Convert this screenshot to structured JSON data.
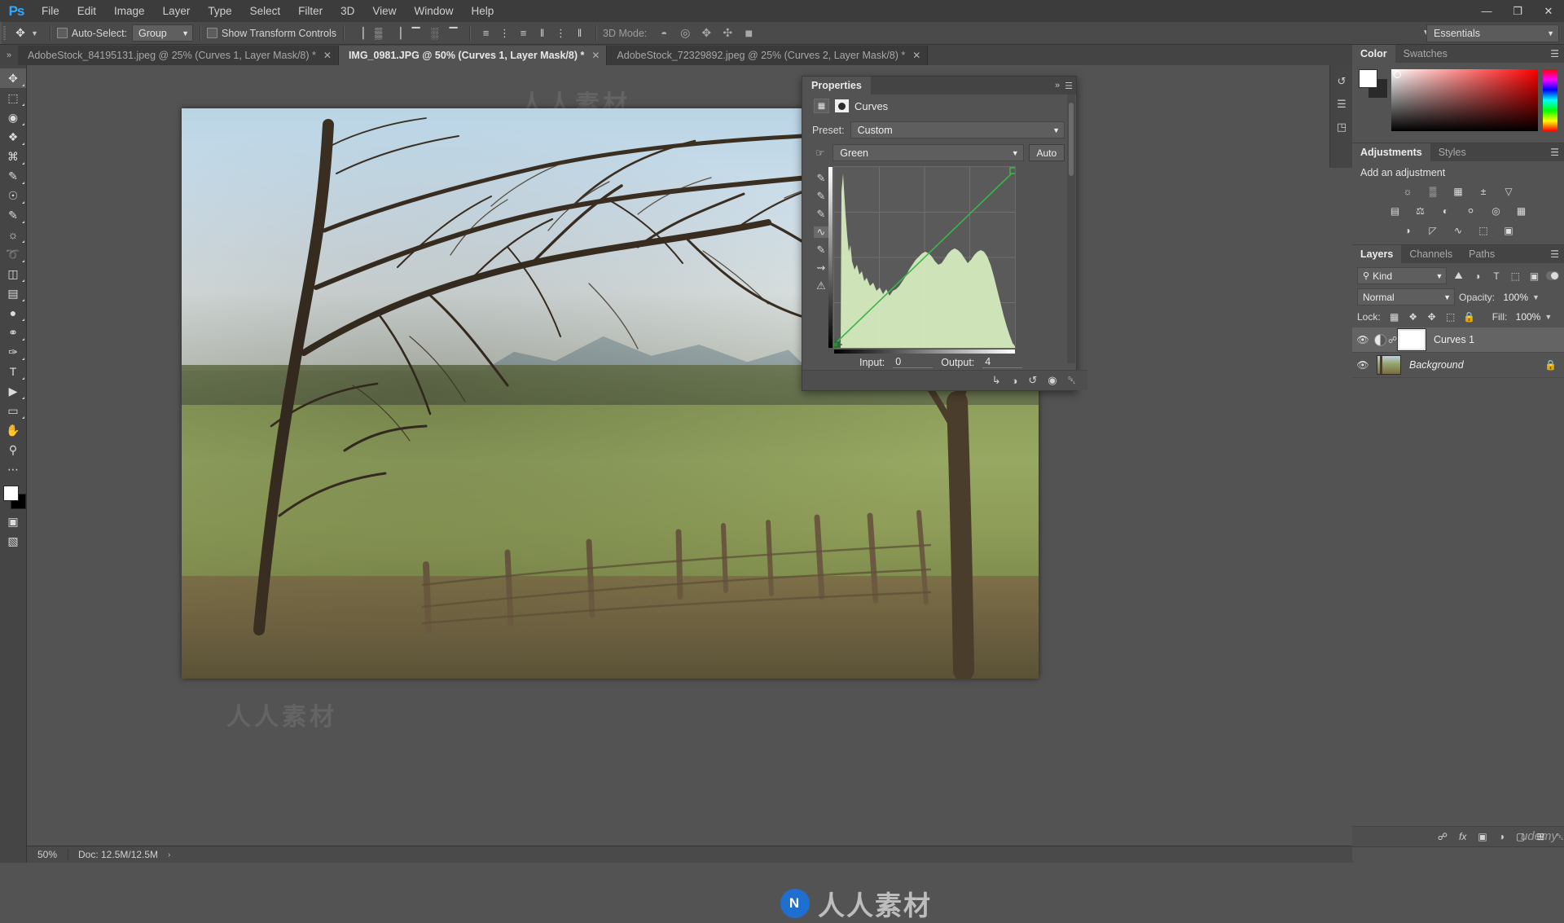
{
  "app": {
    "name": "Ps",
    "logo_icon": "photoshop-logo-icon",
    "workspace": "Essentials"
  },
  "menubar": {
    "items": [
      "File",
      "Edit",
      "Image",
      "Layer",
      "Type",
      "Select",
      "Filter",
      "3D",
      "View",
      "Window",
      "Help"
    ],
    "window_controls": {
      "minimize": "—",
      "maximize": "❐",
      "close": "✕"
    }
  },
  "options_bar": {
    "tool_icon": "move-tool-icon",
    "auto_select_label": "Auto-Select:",
    "auto_select_value": "Group",
    "show_transform_label": "Show Transform Controls",
    "three_d_mode_label": "3D Mode:",
    "align_icons": [
      "align-left-edges-icon",
      "align-horizontal-centers-icon",
      "align-right-edges-icon",
      "align-top-edges-icon",
      "align-vertical-centers-icon",
      "align-bottom-edges-icon"
    ],
    "distribute_icons": [
      "distribute-top-icon",
      "distribute-vertical-centers-icon",
      "distribute-bottom-icon",
      "distribute-left-icon",
      "distribute-horizontal-centers-icon",
      "distribute-right-icon"
    ],
    "three_d_icons": [
      "3d-orbit-icon",
      "3d-roll-icon",
      "3d-pan-icon",
      "3d-slide-icon",
      "3d-scale-camera-icon"
    ]
  },
  "tabs": [
    {
      "label": "AdobeStock_84195131.jpeg @ 25% (Curves 1, Layer Mask/8) *",
      "close": "✕",
      "active": false
    },
    {
      "label": "IMG_0981.JPG @ 50% (Curves 1, Layer Mask/8) *",
      "close": "✕",
      "active": true
    },
    {
      "label": "AdobeStock_72329892.jpeg @ 25% (Curves 2, Layer Mask/8) *",
      "close": "✕",
      "active": false
    }
  ],
  "toolbar": {
    "tools": [
      {
        "name": "move-tool",
        "glyph": "✥",
        "selected": true
      },
      {
        "name": "rectangular-marquee-tool",
        "glyph": "⬚",
        "selected": false
      },
      {
        "name": "lasso-tool",
        "glyph": "◌",
        "selected": false
      },
      {
        "name": "quick-selection-tool",
        "glyph": "✎",
        "selected": false
      },
      {
        "name": "crop-tool",
        "glyph": "⌗",
        "selected": false
      },
      {
        "name": "eyedropper-tool",
        "glyph": "✒",
        "selected": false
      },
      {
        "name": "spot-healing-brush-tool",
        "glyph": "☂",
        "selected": false
      },
      {
        "name": "brush-tool",
        "glyph": "✏",
        "selected": false
      },
      {
        "name": "clone-stamp-tool",
        "glyph": "⚌",
        "selected": false
      },
      {
        "name": "history-brush-tool",
        "glyph": "➰",
        "selected": false
      },
      {
        "name": "eraser-tool",
        "glyph": "◫",
        "selected": false
      },
      {
        "name": "gradient-tool",
        "glyph": "▤",
        "selected": false
      },
      {
        "name": "blur-tool",
        "glyph": "●",
        "selected": false
      },
      {
        "name": "dodge-tool",
        "glyph": "⚲",
        "selected": false
      },
      {
        "name": "pen-tool",
        "glyph": "✑",
        "selected": false
      },
      {
        "name": "horizontal-type-tool",
        "glyph": "T",
        "selected": false
      },
      {
        "name": "path-selection-tool",
        "glyph": "▶",
        "selected": false
      },
      {
        "name": "rectangle-tool",
        "glyph": "▭",
        "selected": false
      },
      {
        "name": "hand-tool",
        "glyph": "✋",
        "selected": false
      },
      {
        "name": "zoom-tool",
        "glyph": "⚲",
        "selected": false
      },
      {
        "name": "edit-toolbar-tool",
        "glyph": "⋯",
        "selected": false
      },
      {
        "name": "default-colors-tool",
        "glyph": "❐",
        "selected": false
      }
    ],
    "foreground_color": "#ffffff",
    "background_color": "#000000",
    "bottom_icons": [
      {
        "name": "quick-mask-mode",
        "glyph": "▣"
      },
      {
        "name": "screen-mode",
        "glyph": "▧"
      }
    ]
  },
  "properties_panel": {
    "tab_label": "Properties",
    "collapse_icon": "double-chevron-right-icon",
    "menu_icon": "panel-menu-icon",
    "adjustment_icon": "curves-grid-icon",
    "mask_icon": "layer-mask-icon",
    "title": "Curves",
    "preset_label": "Preset:",
    "preset_value": "Custom",
    "channel_value": "Green",
    "auto_button": "Auto",
    "input_label": "Input:",
    "input_value": "0",
    "output_label": "Output:",
    "output_value": "4",
    "curve_tools": [
      {
        "name": "on-image-adjustment-icon",
        "glyph": "☝",
        "selected": false
      },
      {
        "name": "black-point-eyedropper-icon",
        "glyph": "✒",
        "selected": false
      },
      {
        "name": "gray-point-eyedropper-icon",
        "glyph": "✒",
        "selected": false
      },
      {
        "name": "white-point-eyedropper-icon",
        "glyph": "✒",
        "selected": false
      },
      {
        "name": "curve-point-tool-icon",
        "glyph": "∿",
        "selected": true
      },
      {
        "name": "pencil-draw-curve-icon",
        "glyph": "✏",
        "selected": false
      },
      {
        "name": "smooth-curve-icon",
        "glyph": "⇝",
        "selected": false
      },
      {
        "name": "clipping-warning-icon",
        "glyph": "⚠",
        "selected": false
      }
    ],
    "footer_icons": [
      {
        "name": "clip-to-layer-icon",
        "glyph": "↳"
      },
      {
        "name": "toggle-previous-state-icon",
        "glyph": "◑"
      },
      {
        "name": "reset-adjustment-icon",
        "glyph": "↺"
      },
      {
        "name": "toggle-layer-visibility-icon",
        "glyph": "◉"
      },
      {
        "name": "delete-adjustment-icon",
        "glyph": "＿"
      }
    ],
    "curve_color": "#3bb54a",
    "histogram_color": "#d8f0c0"
  },
  "color_panel": {
    "tabs": [
      "Color",
      "Swatches"
    ],
    "active_tab": "Color",
    "foreground": "#ffffff",
    "background": "#2a2a2a"
  },
  "adjustments_panel": {
    "tabs": [
      "Adjustments",
      "Styles"
    ],
    "active_tab": "Adjustments",
    "title": "Add an adjustment",
    "row1": [
      {
        "name": "brightness-contrast-icon",
        "glyph": "☼"
      },
      {
        "name": "levels-icon",
        "glyph": "▒"
      },
      {
        "name": "curves-icon",
        "glyph": "⊞"
      },
      {
        "name": "exposure-icon",
        "glyph": "±"
      },
      {
        "name": "vibrance-icon",
        "glyph": "▽"
      }
    ],
    "row2": [
      {
        "name": "hue-saturation-icon",
        "glyph": "☰"
      },
      {
        "name": "color-balance-icon",
        "glyph": "⚖"
      },
      {
        "name": "black-white-icon",
        "glyph": "◐"
      },
      {
        "name": "photo-filter-icon",
        "glyph": "○"
      },
      {
        "name": "channel-mixer-icon",
        "glyph": "◎"
      },
      {
        "name": "color-lookup-icon",
        "glyph": "▦"
      }
    ],
    "row3": [
      {
        "name": "invert-icon",
        "glyph": "◑"
      },
      {
        "name": "posterize-icon",
        "glyph": "◨"
      },
      {
        "name": "threshold-icon",
        "glyph": "∿"
      },
      {
        "name": "gradient-map-icon",
        "glyph": "⬚"
      },
      {
        "name": "selective-color-icon",
        "glyph": "▣"
      }
    ]
  },
  "layers_panel": {
    "tabs": [
      "Layers",
      "Channels",
      "Paths"
    ],
    "active_tab": "Layers",
    "menu_icon": "panel-menu-icon",
    "filter_label": "Kind",
    "filter_icon": "search-icon",
    "filter_type_icons": [
      {
        "name": "filter-pixel-layers-icon",
        "glyph": "⛰"
      },
      {
        "name": "filter-adjustment-layers-icon",
        "glyph": "◑"
      },
      {
        "name": "filter-type-layers-icon",
        "glyph": "T"
      },
      {
        "name": "filter-shape-layers-icon",
        "glyph": "⬚"
      },
      {
        "name": "filter-smart-objects-icon",
        "glyph": "⬜"
      }
    ],
    "blend_mode": "Normal",
    "opacity_label": "Opacity:",
    "opacity_value": "100%",
    "lock_label": "Lock:",
    "lock_icons": [
      {
        "name": "lock-transparent-pixels-icon",
        "glyph": "▦"
      },
      {
        "name": "lock-image-pixels-icon",
        "glyph": "✎"
      },
      {
        "name": "lock-position-icon",
        "glyph": "✥"
      },
      {
        "name": "lock-artboard-nesting-icon",
        "glyph": "⬚"
      },
      {
        "name": "lock-all-icon",
        "glyph": "🔒"
      }
    ],
    "fill_label": "Fill:",
    "fill_value": "100%",
    "layers": [
      {
        "name": "Curves 1",
        "type": "adjustment",
        "visible": true,
        "selected": true,
        "linked": true,
        "locked": false,
        "italic": false
      },
      {
        "name": "Background",
        "type": "pixel",
        "visible": true,
        "selected": false,
        "linked": false,
        "locked": true,
        "italic": true
      }
    ],
    "footer_icons": [
      {
        "name": "link-layers-icon",
        "glyph": "⛓"
      },
      {
        "name": "add-layer-style-icon",
        "glyph": "fx"
      },
      {
        "name": "add-layer-mask-icon",
        "glyph": "▣"
      },
      {
        "name": "new-fill-adjustment-layer-icon",
        "glyph": "◑"
      },
      {
        "name": "new-group-icon",
        "glyph": "▢"
      },
      {
        "name": "new-layer-icon",
        "glyph": "⊞"
      },
      {
        "name": "delete-layer-icon",
        "glyph": "🗑"
      }
    ]
  },
  "right_rail": {
    "icons": [
      {
        "name": "history-panel-icon",
        "glyph": "↺"
      },
      {
        "name": "properties-panel-icon",
        "glyph": "☰"
      },
      {
        "name": "libraries-panel-icon",
        "glyph": "◳"
      }
    ]
  },
  "status_bar": {
    "zoom": "50%",
    "doc_label": "Doc: 12.5M/12.5M",
    "expand_arrow": "›"
  },
  "watermark": {
    "brand": "人人素材",
    "mark": "N",
    "ghost": "人人素材",
    "corner": "udemy"
  }
}
